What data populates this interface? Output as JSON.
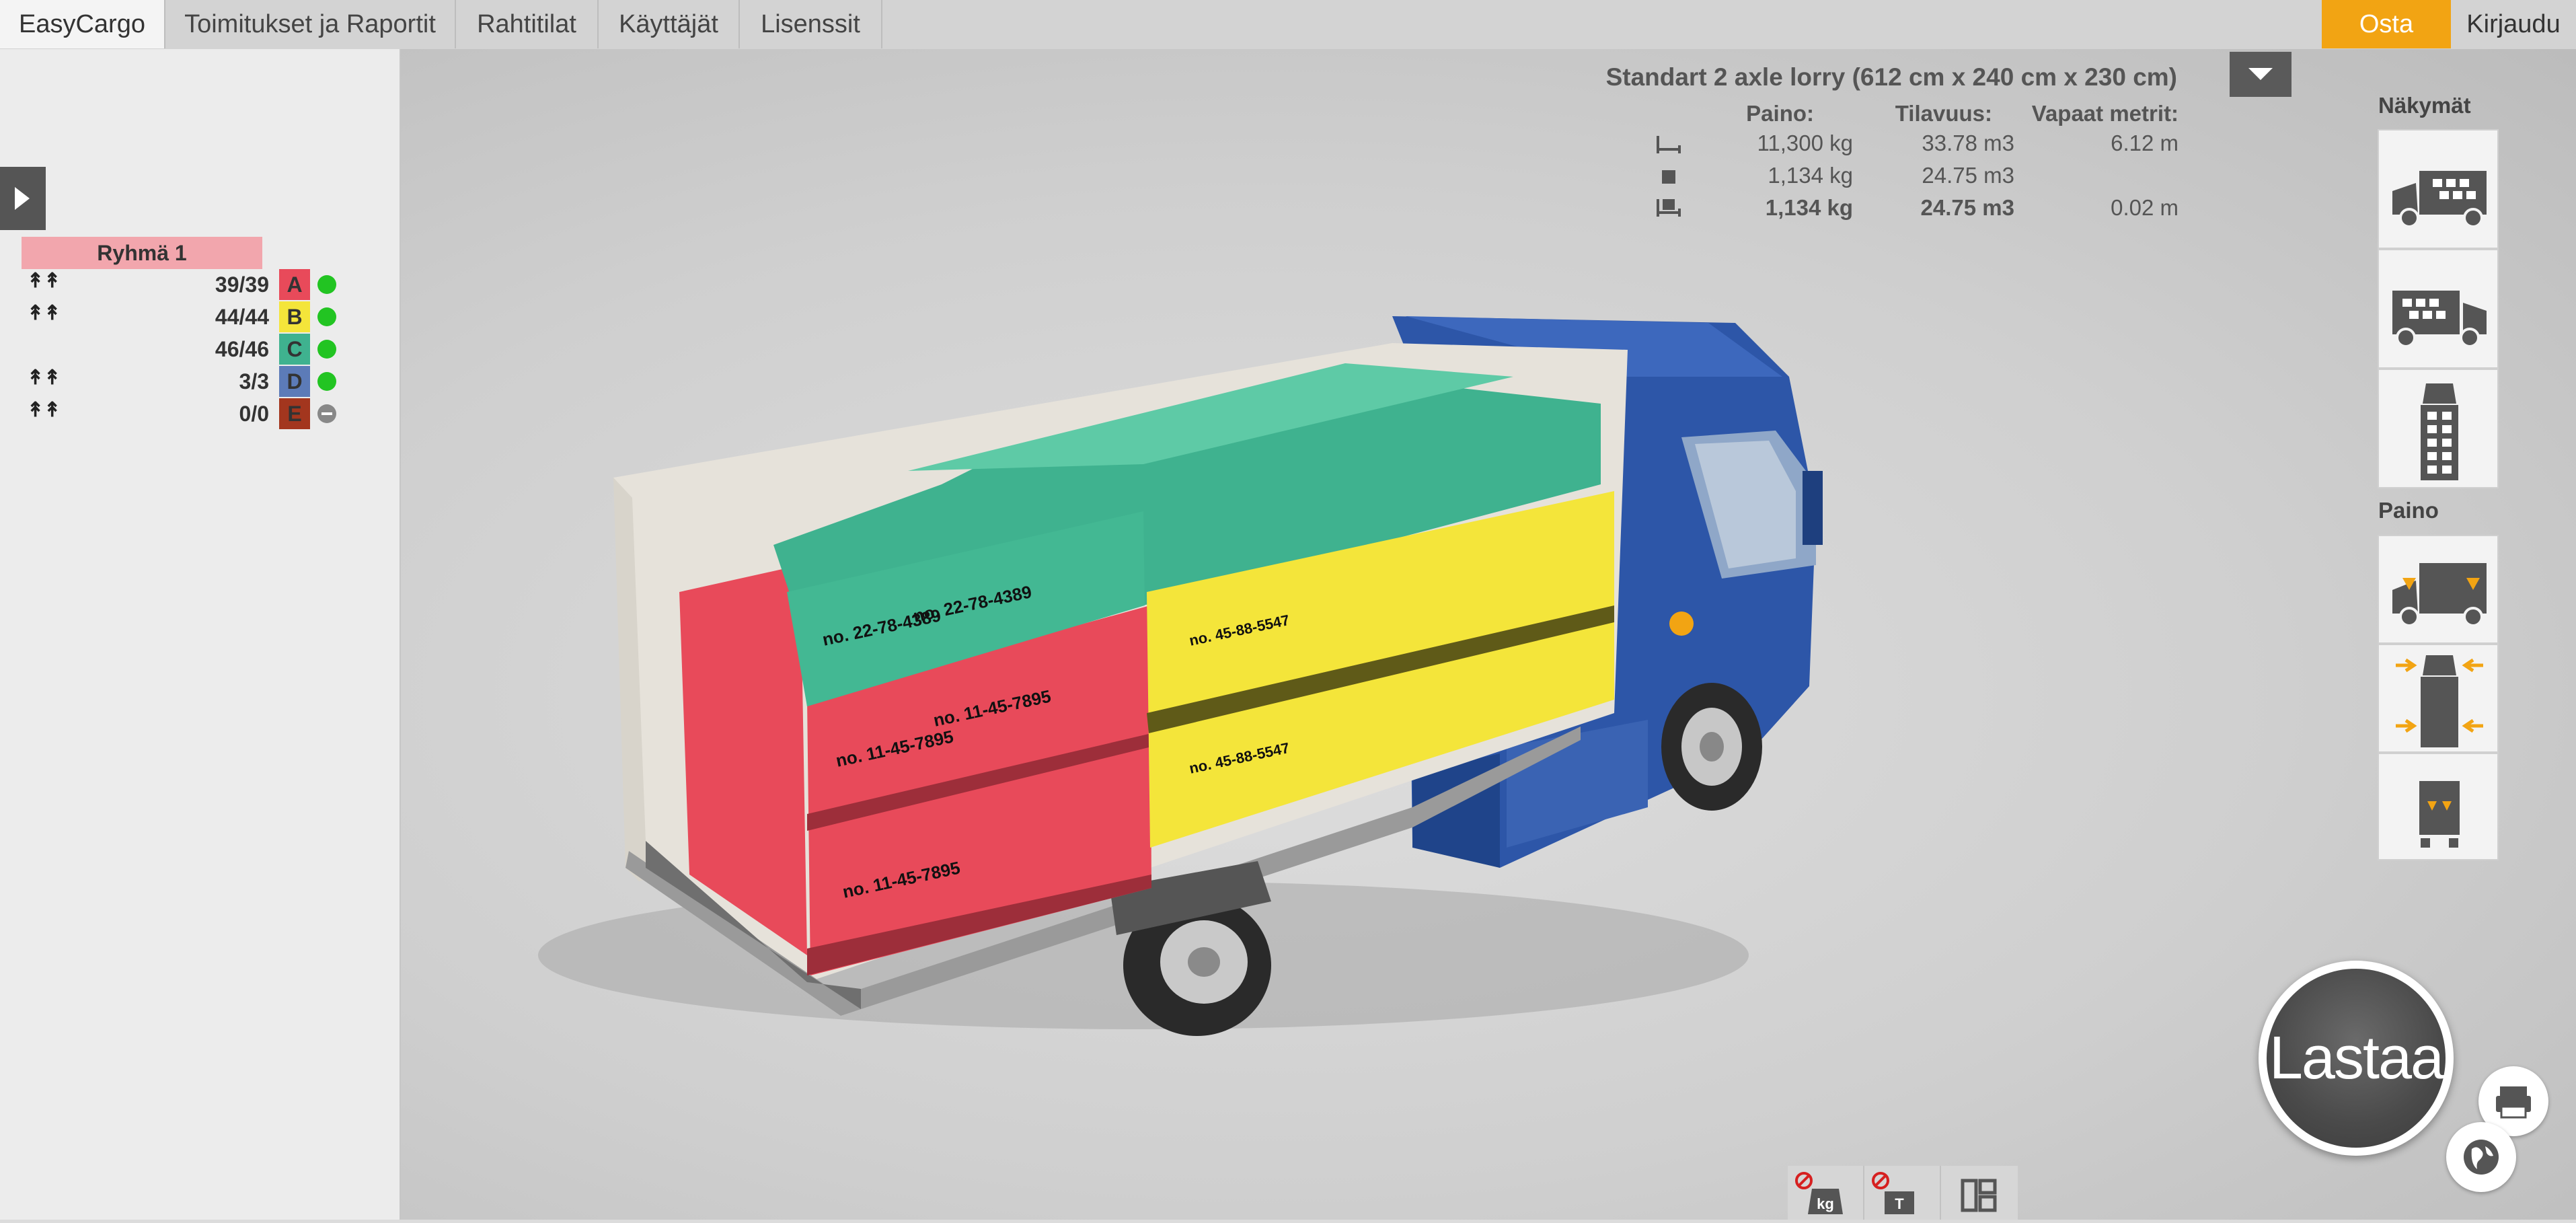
{
  "menu": {
    "tabs": [
      {
        "label": "EasyCargo",
        "active": true
      },
      {
        "label": "Toimitukset ja Raportit",
        "active": false
      },
      {
        "label": "Rahtitilat",
        "active": false
      },
      {
        "label": "Käyttäjät",
        "active": false
      },
      {
        "label": "Lisenssit",
        "active": false
      }
    ],
    "buy_label": "Osta",
    "login_label": "Kirjaudu"
  },
  "cargo_group": {
    "title": "Ryhmä 1",
    "items": [
      {
        "letter": "A",
        "count": "39/39",
        "stackable_icon": "↟↟",
        "color": "#e84a5a",
        "status": "ok"
      },
      {
        "letter": "B",
        "count": "44/44",
        "stackable_icon": "↟↟",
        "color": "#f4e53a",
        "status": "ok"
      },
      {
        "letter": "C",
        "count": "46/46",
        "stackable_icon": "",
        "color": "#3fb28f",
        "status": "ok"
      },
      {
        "letter": "D",
        "count": "3/3",
        "stackable_icon": "↟↟",
        "color": "#5c7bb8",
        "status": "ok"
      },
      {
        "letter": "E",
        "count": "0/0",
        "stackable_icon": "↟↟",
        "color": "#a3361e",
        "status": "none"
      }
    ]
  },
  "vehicle": {
    "title": "Standart 2 axle lorry (612 cm x 240 cm x 230 cm)",
    "headers": {
      "weight": "Paino:",
      "volume": "Tilavuus:",
      "free_meters": "Vapaat metrit:"
    },
    "rows": [
      {
        "icon": "truck-capacity-icon",
        "weight": "11,300 kg",
        "volume": "33.78 m3",
        "free_meters": "6.12 m",
        "bold": false
      },
      {
        "icon": "cargo-box-icon",
        "weight": "1,134 kg",
        "volume": "24.75 m3",
        "free_meters": "",
        "bold": false
      },
      {
        "icon": "loaded-truck-icon",
        "weight": "1,134 kg",
        "volume": "24.75 m3",
        "free_meters": "0.02 m",
        "bold": true
      }
    ]
  },
  "views": {
    "heading": "Näkymät",
    "buttons": [
      "side-view-icon",
      "side-view-rear-icon",
      "top-view-icon"
    ]
  },
  "weight_section": {
    "heading": "Paino",
    "buttons": [
      "axle-load-icon",
      "weight-distribution-icon",
      "rear-load-icon"
    ]
  },
  "box_labels": {
    "red": "no. 11-45-7895",
    "green": "no. 22-78-4389",
    "yellow": "no. 45-88-5547"
  },
  "actions": {
    "load_label": "Lastaa"
  },
  "colors": {
    "accent": "#f2a413",
    "red_box": "#e84a5a",
    "yellow_box": "#f4e53a",
    "green_box": "#3fb28f",
    "truck_blue": "#2d56a8",
    "status_ok": "#22c422",
    "status_none": "#888888"
  }
}
